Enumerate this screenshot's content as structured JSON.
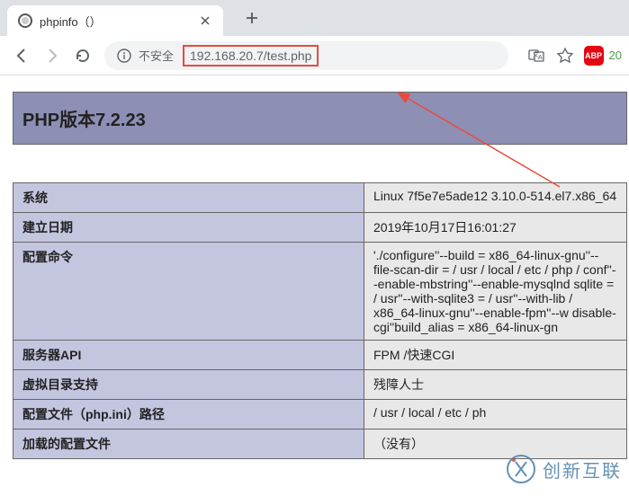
{
  "tab": {
    "title": "phpinfo（）",
    "favicon": "php-icon"
  },
  "toolbar": {
    "security_label": "不安全",
    "url": "192.168.20.7/test.php",
    "count": "20"
  },
  "page": {
    "title": "PHP版本7.2.23"
  },
  "rows": [
    {
      "key": "系统",
      "val": "Linux 7f5e7e5ade12 3.10.0-514.el7.x86_64"
    },
    {
      "key": "建立日期",
      "val": "2019年10月17日16:01:27"
    },
    {
      "key": "配置命令",
      "val": "'./configure''--build = x86_64-linux-gnu''--file-scan-dir = / usr / local / etc / php / conf''--enable-mbstring''--enable-mysqlnd sqlite = / usr''--with-sqlite3 = / usr''--with-lib / x86_64-linux-gnu''--enable-fpm''--w disable-cgi''build_alias = x86_64-linux-gn"
    },
    {
      "key": "服务器API",
      "val": "FPM /快速CGI"
    },
    {
      "key": "虚拟目录支持",
      "val": "残障人士"
    },
    {
      "key": "配置文件（php.ini）路径",
      "val": "/ usr / local / etc / ph"
    },
    {
      "key": "加载的配置文件",
      "val": "（没有）"
    }
  ],
  "watermark": {
    "text": "创新互联"
  }
}
